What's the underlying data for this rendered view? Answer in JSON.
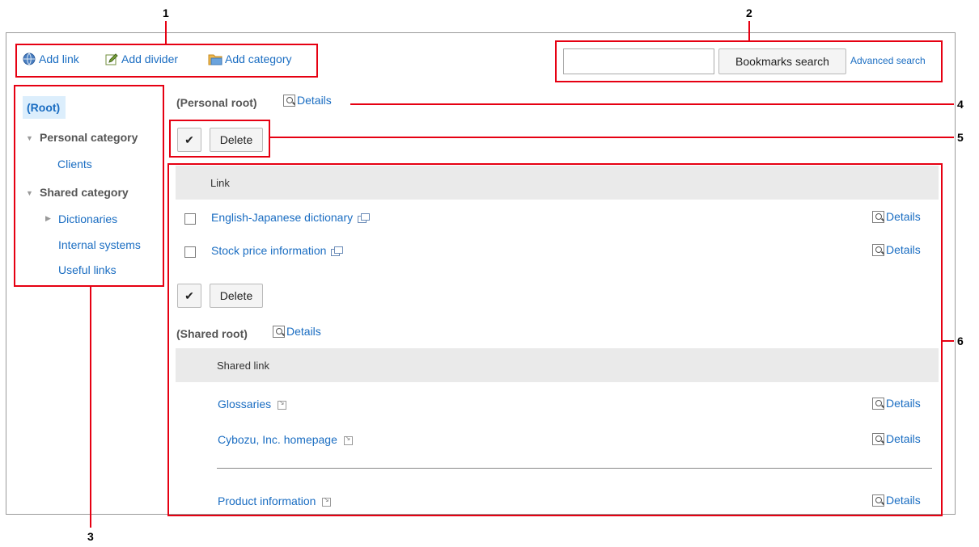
{
  "callouts": [
    "1",
    "2",
    "3",
    "4",
    "5",
    "6"
  ],
  "toolbar": {
    "add_link": "Add link",
    "add_divider": "Add divider",
    "add_category": "Add category"
  },
  "search": {
    "value": "",
    "button": "Bookmarks search",
    "advanced": "Advanced search"
  },
  "sidebar": {
    "root": "(Root)",
    "personal_category": "Personal category",
    "clients": "Clients",
    "shared_category": "Shared category",
    "dictionaries": "Dictionaries",
    "internal_systems": "Internal systems",
    "useful_links": "Useful links"
  },
  "personal": {
    "title": "(Personal root)",
    "details": "Details",
    "delete_label": "Delete",
    "column_header": "Link",
    "links": [
      {
        "label": "English-Japanese dictionary",
        "details": "Details"
      },
      {
        "label": "Stock price information",
        "details": "Details"
      }
    ]
  },
  "shared": {
    "title": "(Shared root)",
    "details": "Details",
    "column_header": "Shared link",
    "links": [
      {
        "label": "Glossaries",
        "details": "Details"
      },
      {
        "label": "Cybozu, Inc. homepage",
        "details": "Details"
      },
      {
        "label": "Product information",
        "details": "Details"
      }
    ]
  },
  "colors": {
    "callout": "#e60012",
    "link": "#1a6dc2",
    "selected_bg": "#dceefc",
    "header_bg": "#eaeaea"
  }
}
